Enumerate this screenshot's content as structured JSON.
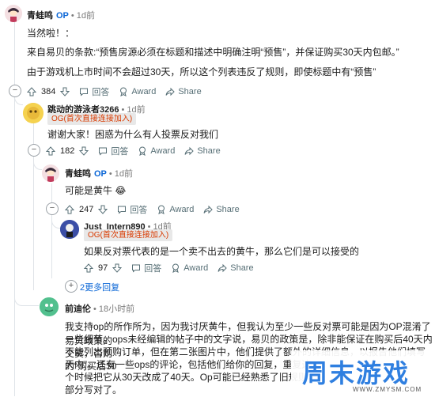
{
  "comments": [
    {
      "username": "青蛙鸣",
      "op_badge": "OP",
      "time": "1d前",
      "body": [
        "当然啦！：",
        "来自易贝的条款:“预售房源必须在标题和描述中明确注明“预售”，并保证购买30天内包邮。”",
        "由于游戏机上市时间不会超过30天，所以这个列表违反了规则，即使标题中有“预售”"
      ],
      "votes": "384",
      "reply_label": "回答",
      "award_label": "Award",
      "share_label": "Share"
    },
    {
      "username": "跳动的游泳者3266",
      "time": "1d前",
      "flair": "OG(首次直接连接加入)",
      "body": [
        "谢谢大家！困惑为什么有人投票反对我们"
      ],
      "votes": "182",
      "reply_label": "回答",
      "award_label": "Award",
      "share_label": "Share"
    },
    {
      "username": "青蛙鸣",
      "op_badge": "OP",
      "time": "1d前",
      "body": [
        "可能是黄牛 😂"
      ],
      "votes": "247",
      "reply_label": "回答",
      "award_label": "Award",
      "share_label": "Share"
    },
    {
      "username": "Just_Intern890",
      "time": "1d前",
      "flair": "OG(首次直接连接加入)",
      "body": [
        "如果反对票代表的是一个卖不出去的黄牛，那么它们是可以接受的"
      ],
      "votes": "97",
      "reply_label": "回答",
      "award_label": "Award",
      "share_label": "Share"
    },
    {
      "username": "前迪伦",
      "time": "18小时前",
      "body": [
        "我支持op的所作所为，因为我讨厌黄牛，但我认为至少一些反对票可能是因为OP混淆了易贝政策的",
        "一些细节。ops未经编辑的帖子中的文字说，易贝的政策是，除非能保证在购买后40天内交货，否则",
        "不能列出预购订单，但在第二张图片中，他们提供了额外的详细信息，以报告他们填写的“购买后30",
        "天内”。还有一些ops的评论，包括他们给你的回复，重复这",
        "个时候把它从30天改成了40天。Op可能已经熟悉了旧规则，",
        "部分写对了。"
      ]
    }
  ],
  "more_replies": "2更多回复",
  "watermark": {
    "brand": "周末游戏",
    "url": "WWW.ZMYSM.COM"
  },
  "colors": {
    "op": "#0a66d6",
    "flair_text": "#d93a00",
    "flair_bg": "#e8e8e8",
    "watermark_blue": "#2f7fe0",
    "watermark_red": "#e8423a"
  }
}
